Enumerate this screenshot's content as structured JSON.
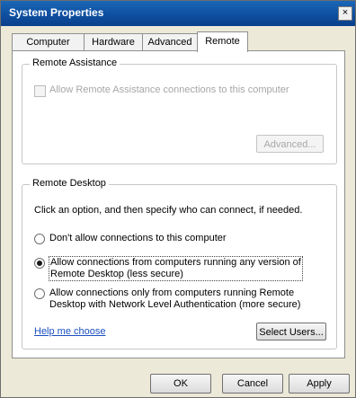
{
  "window": {
    "title": "System Properties",
    "close_glyph": "×"
  },
  "tabs": [
    {
      "label": "Computer Name",
      "active": false
    },
    {
      "label": "Hardware",
      "active": false
    },
    {
      "label": "Advanced",
      "active": false
    },
    {
      "label": "Remote",
      "active": true
    }
  ],
  "remote_assistance": {
    "group_label": "Remote Assistance",
    "checkbox_label": "Allow Remote Assistance connections to this computer",
    "checkbox_checked": false,
    "advanced_button": "Advanced..."
  },
  "remote_desktop": {
    "group_label": "Remote Desktop",
    "instruction": "Click an option, and then specify who can connect, if needed.",
    "options": [
      {
        "label_line1": "Don't allow connections to this computer",
        "label_line2": "",
        "selected": false
      },
      {
        "label_line1": "Allow connections from computers running any version of",
        "label_line2": "Remote Desktop (less secure)",
        "selected": true
      },
      {
        "label_line1": "Allow connections only from computers running Remote",
        "label_line2": "Desktop with Network Level Authentication (more secure)",
        "selected": false
      }
    ],
    "help_link": "Help me choose",
    "select_users_button": "Select Users..."
  },
  "footer": {
    "ok": "OK",
    "cancel": "Cancel",
    "apply": "Apply"
  }
}
